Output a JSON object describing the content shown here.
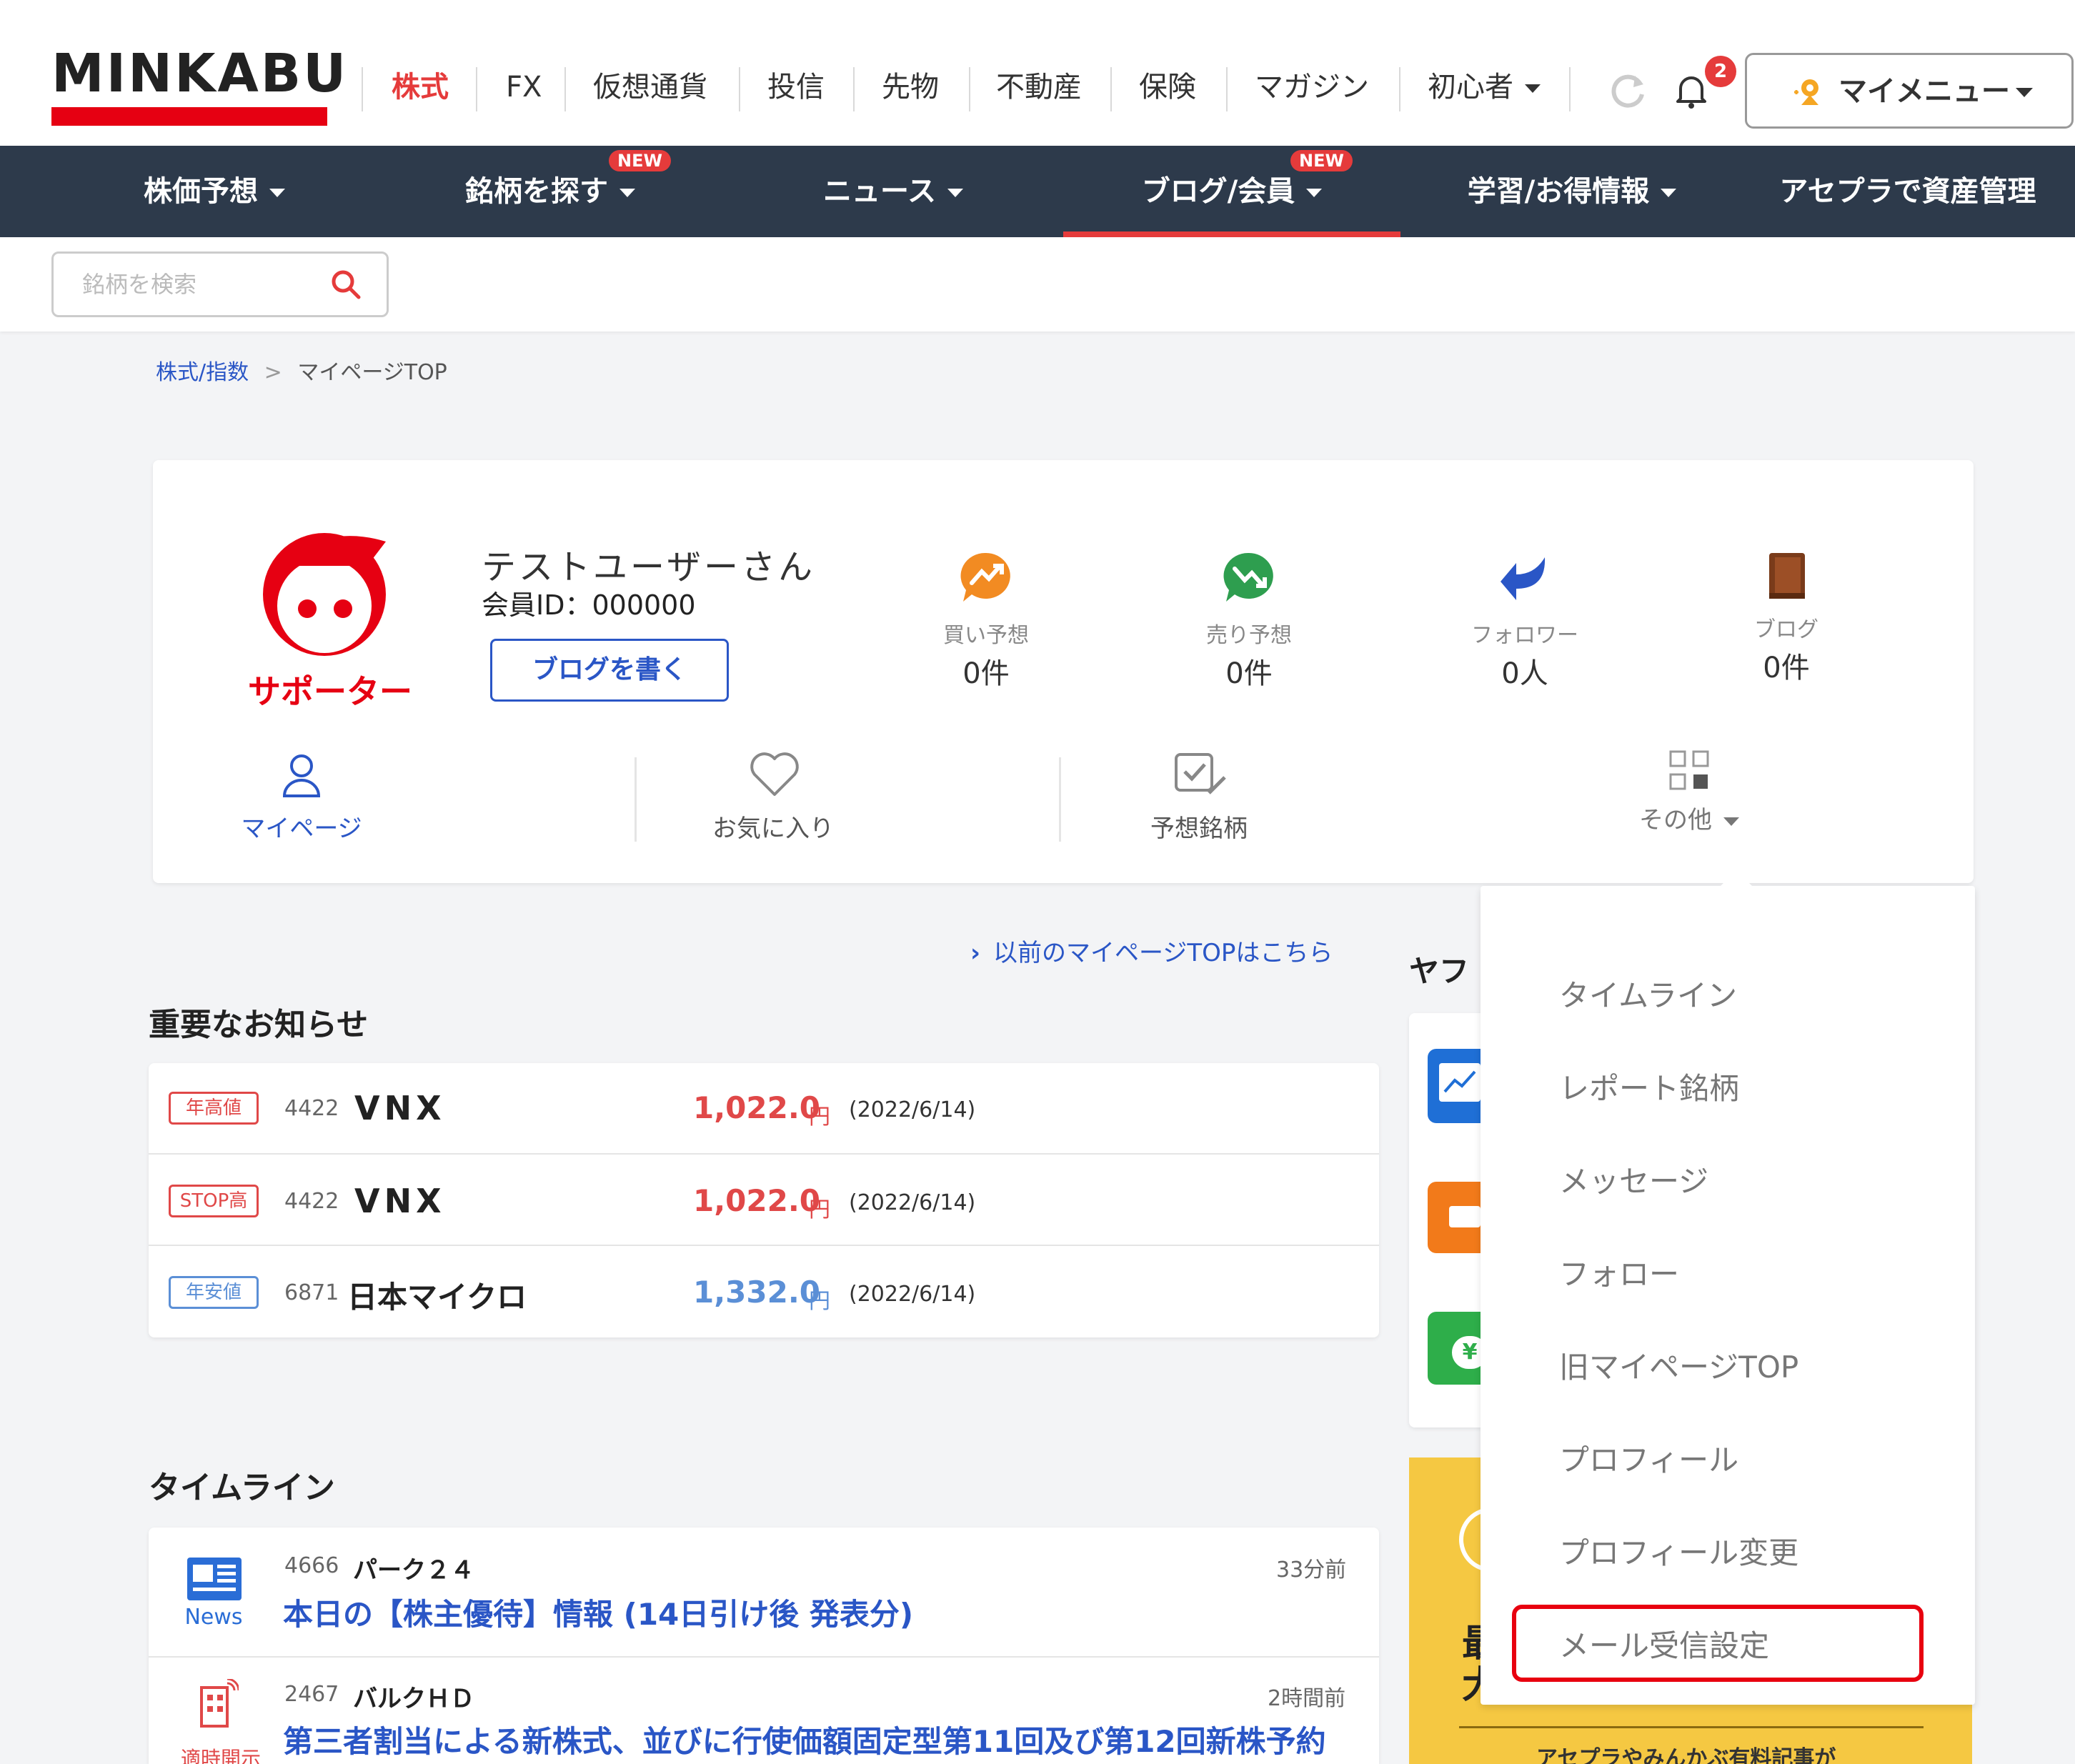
{
  "header": {
    "logo": "MINKABU",
    "nav": [
      "株式",
      "FX",
      "仮想通貨",
      "投信",
      "先物",
      "不動産",
      "保険",
      "マガジン",
      "初心者"
    ],
    "notification_count": "2",
    "my_menu": "マイメニュー"
  },
  "main_nav": {
    "items": [
      "株価予想",
      "銘柄を探す",
      "ニュース",
      "ブログ/会員",
      "学習/お得情報",
      "アセプラで資産管理"
    ],
    "new_badge": "NEW"
  },
  "search": {
    "placeholder": "銘柄を検索"
  },
  "breadcrumb": {
    "home": "株式/指数",
    "sep": ">",
    "current": "マイページTOP"
  },
  "profile": {
    "supporter_label": "サポーター",
    "username": "テストユーザーさん",
    "member_id": "会員ID：000000",
    "write_blog": "ブログを書く",
    "stats": [
      {
        "label": "買い予想",
        "value": "0件"
      },
      {
        "label": "売り予想",
        "value": "0件"
      },
      {
        "label": "フォロワー",
        "value": "0人"
      },
      {
        "label": "ブログ",
        "value": "0件"
      }
    ],
    "quick_links": [
      "マイページ",
      "お気に入り",
      "予想銘柄",
      "その他"
    ]
  },
  "old_mypage_link": "以前のマイページTOPはこちら",
  "notices": {
    "title": "重要なお知らせ",
    "rows": [
      {
        "badge": "年高値",
        "code": "4422",
        "name": "VNX",
        "price": "1,022.0",
        "unit": "円",
        "date": "(2022/6/14)"
      },
      {
        "badge": "STOP高",
        "code": "4422",
        "name": "VNX",
        "price": "1,022.0",
        "unit": "円",
        "date": "(2022/6/14)"
      },
      {
        "badge": "年安値",
        "code": "6871",
        "name": "日本マイクロ",
        "price": "1,332.0",
        "unit": "円",
        "date": "(2022/6/14)"
      }
    ]
  },
  "timeline": {
    "title": "タイムライン",
    "items": [
      {
        "icon_label": "News",
        "code": "4666",
        "company": "パーク２４",
        "time": "33分前",
        "headline": "本日の【株主優待】情報 (14日引け後 発表分)"
      },
      {
        "icon_label": "適時開示",
        "code": "2467",
        "company": "バルクＨＤ",
        "time": "2時間前",
        "headline": "第三者割当による新株式、並びに行使価額固定型第11回及び第12回新株予約"
      }
    ]
  },
  "sidebar": {
    "title_partial": "ヤフ",
    "banner_partial": "最大",
    "banner_bottom": "アセプラやみんかぶ有料記事が"
  },
  "dropdown": {
    "items": [
      "タイムライン",
      "レポート銘柄",
      "メッセージ",
      "フォロー",
      "旧マイページTOP",
      "プロフィール",
      "プロフィール変更",
      "メール受信設定"
    ],
    "highlighted": "メール受信設定"
  },
  "colors": {
    "brand_red": "#e60012",
    "nav_bg": "#2d3a4b",
    "price_up": "#e04848",
    "price_down": "#5b8fd6",
    "link_blue": "#2a56c6",
    "highlight_border": "#e8000f"
  }
}
